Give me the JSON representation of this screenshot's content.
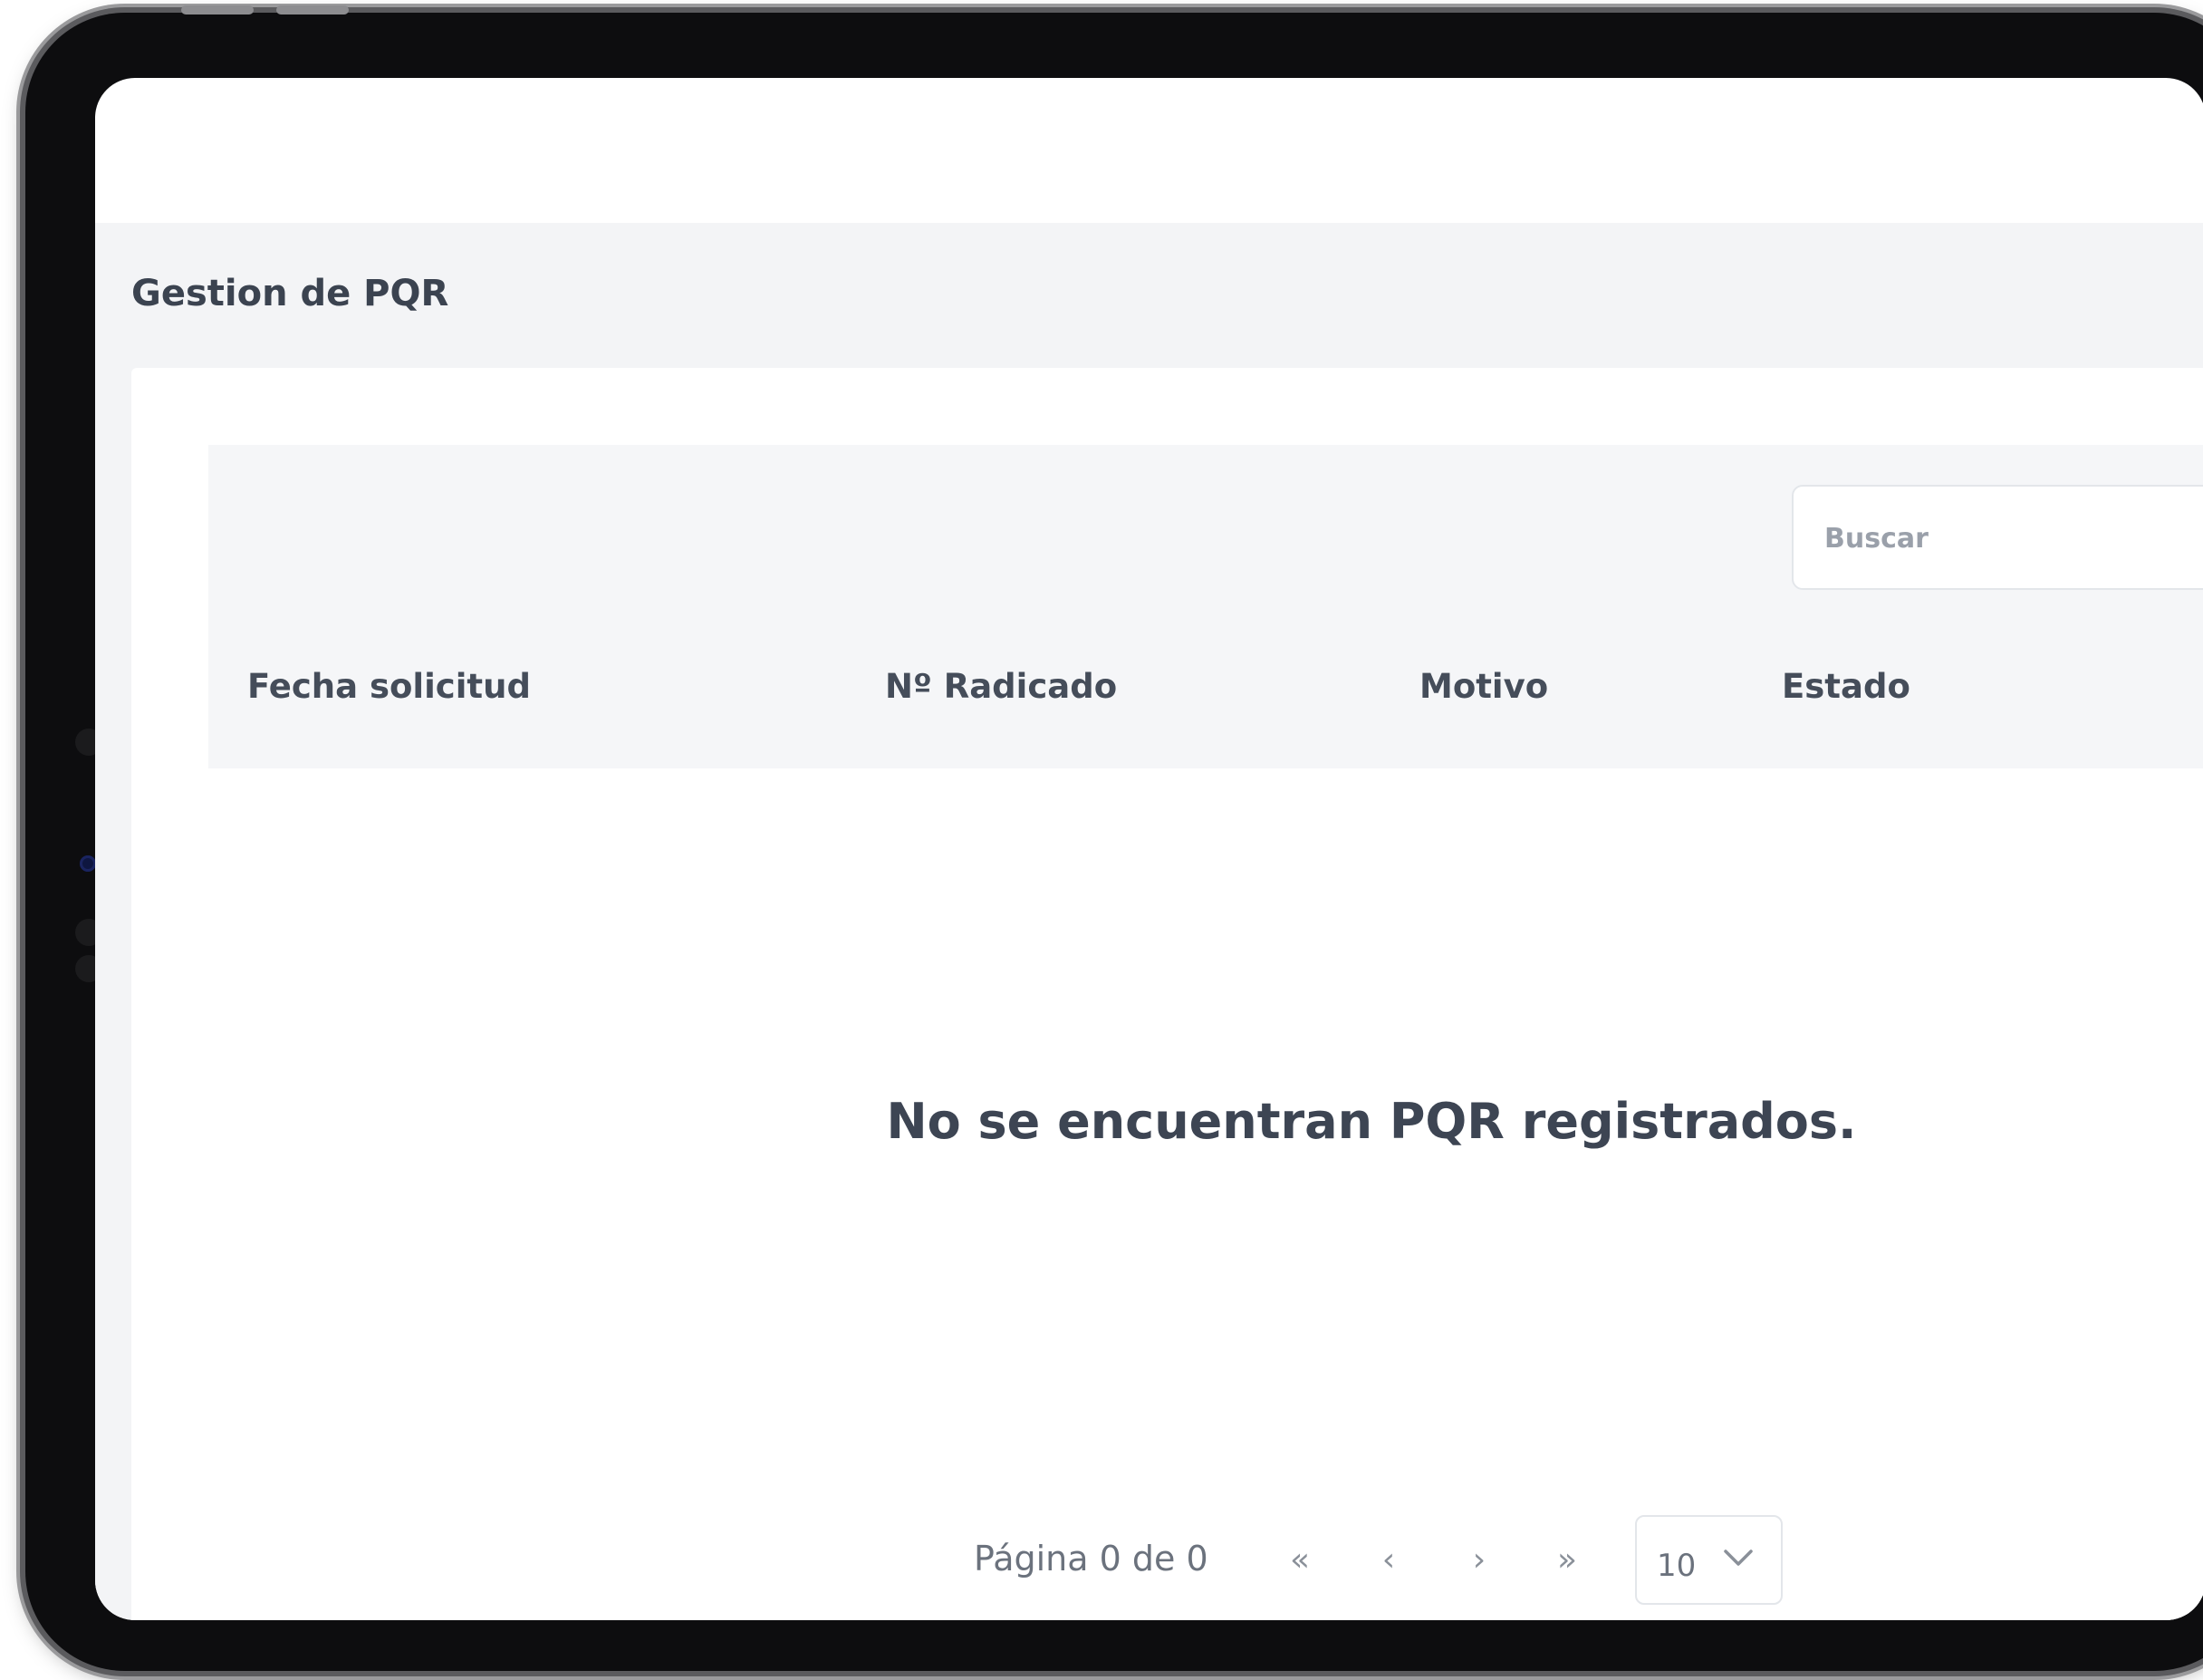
{
  "page": {
    "title": "Gestion de PQR"
  },
  "search": {
    "placeholder": "Buscar",
    "value": ""
  },
  "table": {
    "columns": [
      "Fecha solicitud",
      "Nº Radicado",
      "Motivo",
      "Estado"
    ],
    "rows": [],
    "empty_message": "No se encuentran PQR registrados."
  },
  "pagination": {
    "info": "Página 0 de 0",
    "first_label": "«",
    "prev_label": "‹",
    "next_label": "›",
    "last_label": "»",
    "page_size": "10"
  },
  "colors": {
    "background_gray": "#f3f4f6",
    "header_gray": "#f5f6f8",
    "text_dark": "#3d4553",
    "text_muted": "#6b727d"
  }
}
